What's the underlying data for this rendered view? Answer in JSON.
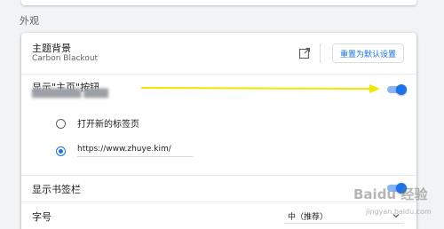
{
  "section": {
    "title": "外观"
  },
  "theme": {
    "label": "主题背景",
    "value": "Carbon Blackout",
    "reset_button": "重置为默认设置"
  },
  "home_button": {
    "label": "显示\"主页\"按钮",
    "enabled": true,
    "options": [
      {
        "label": "打开新的标签页",
        "selected": false
      },
      {
        "label": "",
        "selected": true,
        "value": "https://www.zhuye.kim/"
      }
    ]
  },
  "bookmarks_bar": {
    "label": "显示书签栏",
    "enabled": true
  },
  "font_size": {
    "label": "字号",
    "selected": "中（推荐）"
  },
  "annotation": {
    "arrow_color": "#f5e600"
  },
  "watermark": {
    "text": "Baidu 经验",
    "url": "jingyan.baidu.com"
  },
  "colors": {
    "accent": "#1a73e8",
    "toggle_track": "#8ab4f8"
  },
  "icons": [
    "external-link-icon",
    "dropdown-caret-icon"
  ]
}
